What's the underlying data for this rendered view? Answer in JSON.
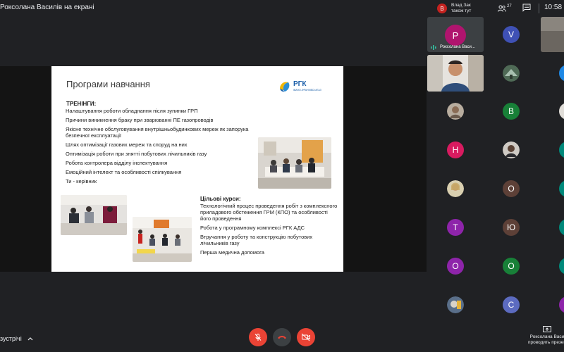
{
  "topbar": {
    "presenter_title": "Роксолана Василів на екрані",
    "joiner_initial": "В",
    "joiner_line1": "Влад Зак",
    "joiner_line2": "також тут",
    "people_count": "27",
    "time": "10:58"
  },
  "slide": {
    "title": "Програми навчання",
    "logo_name": "РГК",
    "logo_sub": "ІВАНО-ФРАНКІВСЬКГАЗ",
    "trainings_heading": "ТРЕНІНГИ:",
    "trainings": [
      "Налаштування роботи обладнання після зупинки ГРП",
      "Причини виникнення браку при зварюванні ПЕ газопроводів",
      "Якісне технічне обслуговування внутрішньобудинкових мереж як запорука безпечної експлуатації",
      "Шлях оптимізації газових мереж та споруд на них",
      "Оптимізація роботи при знятті побутових лічильників газу",
      "Робота контролера відділу інспектування",
      "Емоційний інтелект та особливості спілкування",
      "Ти - керівник"
    ],
    "courses_heading": "Цільові курси:",
    "courses": [
      "Технологічний процес  проведення робіт з комплексного приладового обстеження ГРМ (КПО) та особливості його проведення",
      "Робота у програмному комплексі РГК АДС",
      "Втручання у роботу та конструкцію побутових лічильників газу",
      "Перша медична допомога"
    ]
  },
  "participants": {
    "self": {
      "initial": "Р",
      "name": "Роксолана Васи..."
    },
    "grid": [
      {
        "initial": "V",
        "color": "#3f51b5"
      },
      {
        "initial": "В",
        "color": "#188038"
      },
      {
        "initial": "Н",
        "color": "#d81b60"
      },
      {
        "initial": "О",
        "color": "#5d4037"
      },
      {
        "initial": "Т",
        "color": "#8e24aa"
      },
      {
        "initial": "Ю",
        "color": "#5d4037"
      },
      {
        "initial": "О",
        "color": "#8e24aa"
      },
      {
        "initial": "О",
        "color": "#188038"
      },
      {
        "initial": "С",
        "color": "#5c6bc0"
      }
    ]
  },
  "bottombar": {
    "meeting_label": "зустрічі",
    "presenting_line1": "Роксолана Васи",
    "presenting_line2": "проводить презен"
  },
  "colors": {
    "background": "#202124",
    "mic_off": "#ea4335",
    "leave": "#3c4043",
    "accent_blue": "#1a5ea8"
  },
  "icons": [
    "people-icon",
    "chat-icon",
    "mic-off-icon",
    "hang-up-icon",
    "camera-off-icon",
    "present-icon",
    "chevron-up-icon"
  ]
}
